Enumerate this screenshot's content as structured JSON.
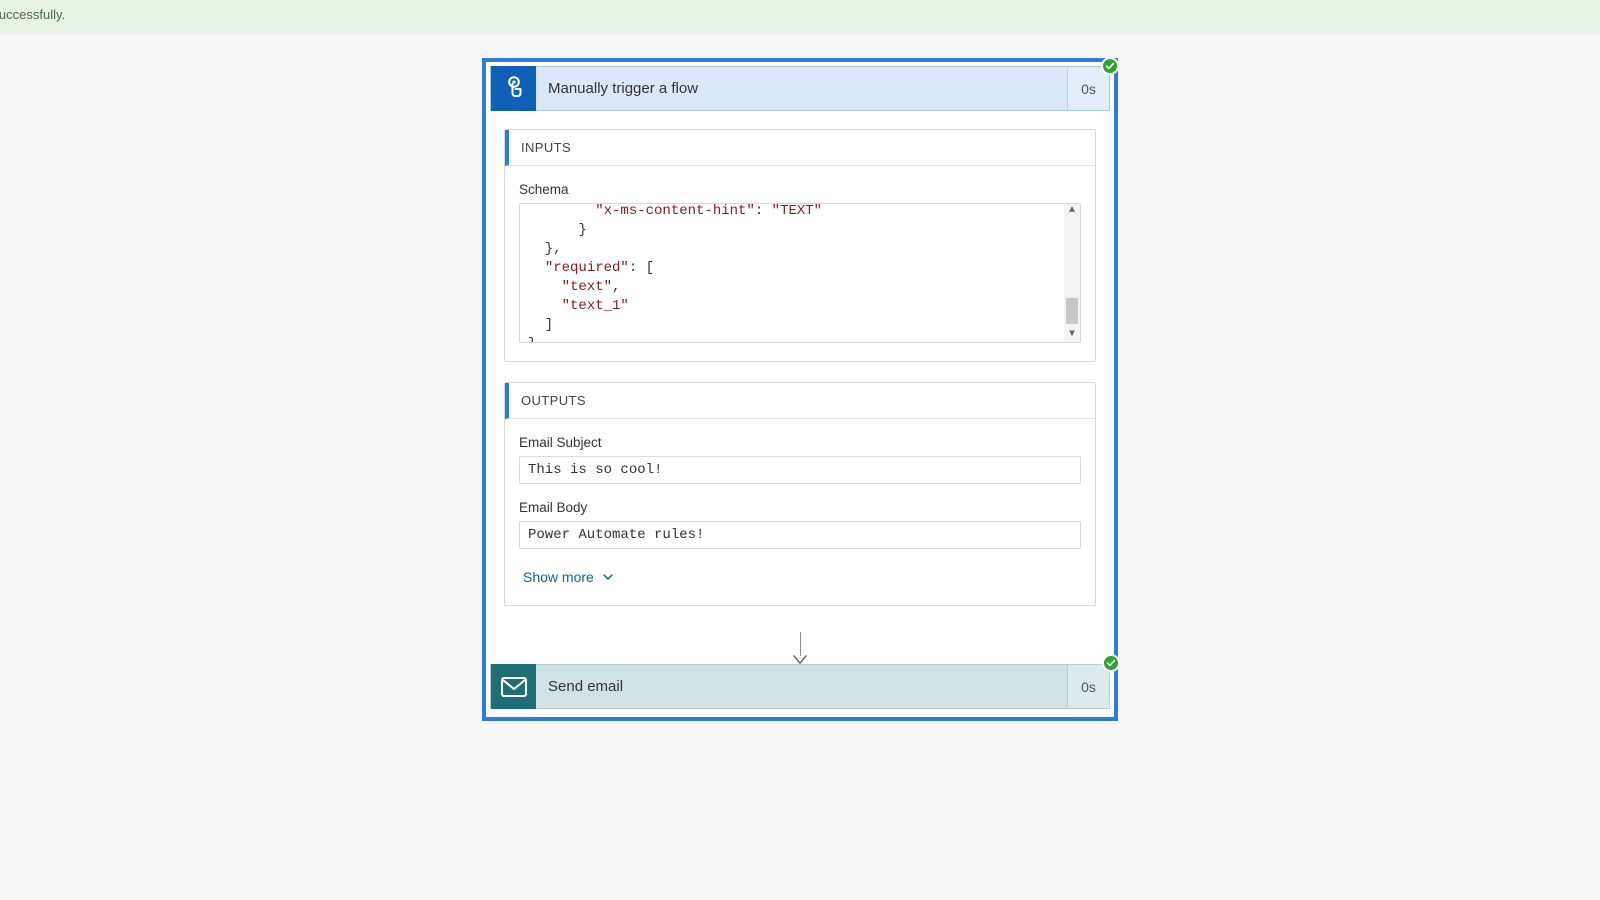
{
  "banner": {
    "text": "ran successfully."
  },
  "trigger": {
    "title": "Manually trigger a flow",
    "duration": "0s",
    "status": "success"
  },
  "inputs": {
    "section_label": "INPUTS",
    "schema_label": "Schema",
    "schema_lines": [
      "        \"x-ms-content-hint\": \"TEXT\"",
      "      }",
      "  },",
      "  \"required\": [",
      "    \"text\",",
      "    \"text_1\"",
      "  ]",
      "}"
    ]
  },
  "outputs": {
    "section_label": "OUTPUTS",
    "fields": [
      {
        "label": "Email Subject",
        "value": "This is so cool!"
      },
      {
        "label": "Email Body",
        "value": "Power Automate rules!"
      }
    ],
    "show_more": "Show more"
  },
  "action2": {
    "title": "Send email",
    "duration": "0s",
    "status": "success"
  }
}
